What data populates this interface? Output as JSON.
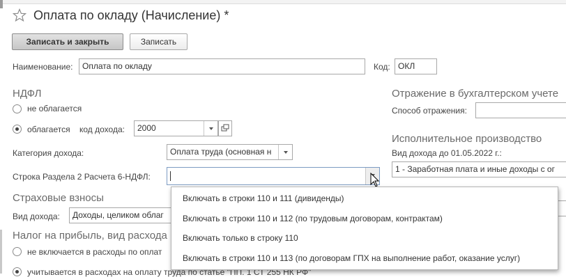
{
  "window": {
    "title": "Оплата по окладу (Начисление) *"
  },
  "toolbar": {
    "save_close_label": "Записать и закрыть",
    "save_label": "Записать"
  },
  "form": {
    "name_label": "Наименование:",
    "name_value": "Оплата по окладу",
    "code_label": "Код:",
    "code_value": "ОКЛ",
    "ndfl": {
      "section_title": "НДФЛ",
      "not_taxed_label": "не облагается",
      "taxed_label": "облагается",
      "income_code_label": "код дохода:",
      "income_code_value": "2000",
      "selected": "taxed"
    },
    "income_category_label": "Категория дохода:",
    "income_category_value": "Оплата труда (основная н",
    "row_6ndfl_label": "Строка Раздела 2 Расчета 6-НДФЛ:",
    "row_6ndfl_value": "",
    "insurance": {
      "section_title": "Страховые взносы",
      "income_type_label": "Вид дохода:",
      "income_type_value": "Доходы, целиком облаг"
    },
    "profit_tax": {
      "section_title": "Налог на прибыль, вид расхода",
      "option1": "не включается в расходы по оплат",
      "option2": "учитывается в расходах на оплату труда по статье \"ПП. 1 СТ 255 НК РФ\""
    },
    "accounting": {
      "section_title": "Отражение в бухгалтерском учете",
      "method_label": "Способ отражения:",
      "method_value": ""
    },
    "enforcement": {
      "section_title": "Исполнительное производство",
      "income_type_label": "Вид дохода до 01.05.2022 г.:",
      "income_type_value": "1 - Заработная плата и иные доходы с ог"
    }
  },
  "dropdown_options": [
    "Включать в строки 110 и 111 (дивиденды)",
    "Включать в строки 110 и 112 (по трудовым договорам, контрактам)",
    "Включать только в строку 110",
    "Включать в строки 110 и 113 (по договорам ГПХ на выполнение работ, оказание услуг)"
  ],
  "icons": [
    "star-icon",
    "open-icon",
    "chevron-down-icon",
    "mouse-cursor-icon"
  ],
  "colors": {
    "section_title": "#6a6a6a",
    "primary_button": "#c6c6c6"
  }
}
